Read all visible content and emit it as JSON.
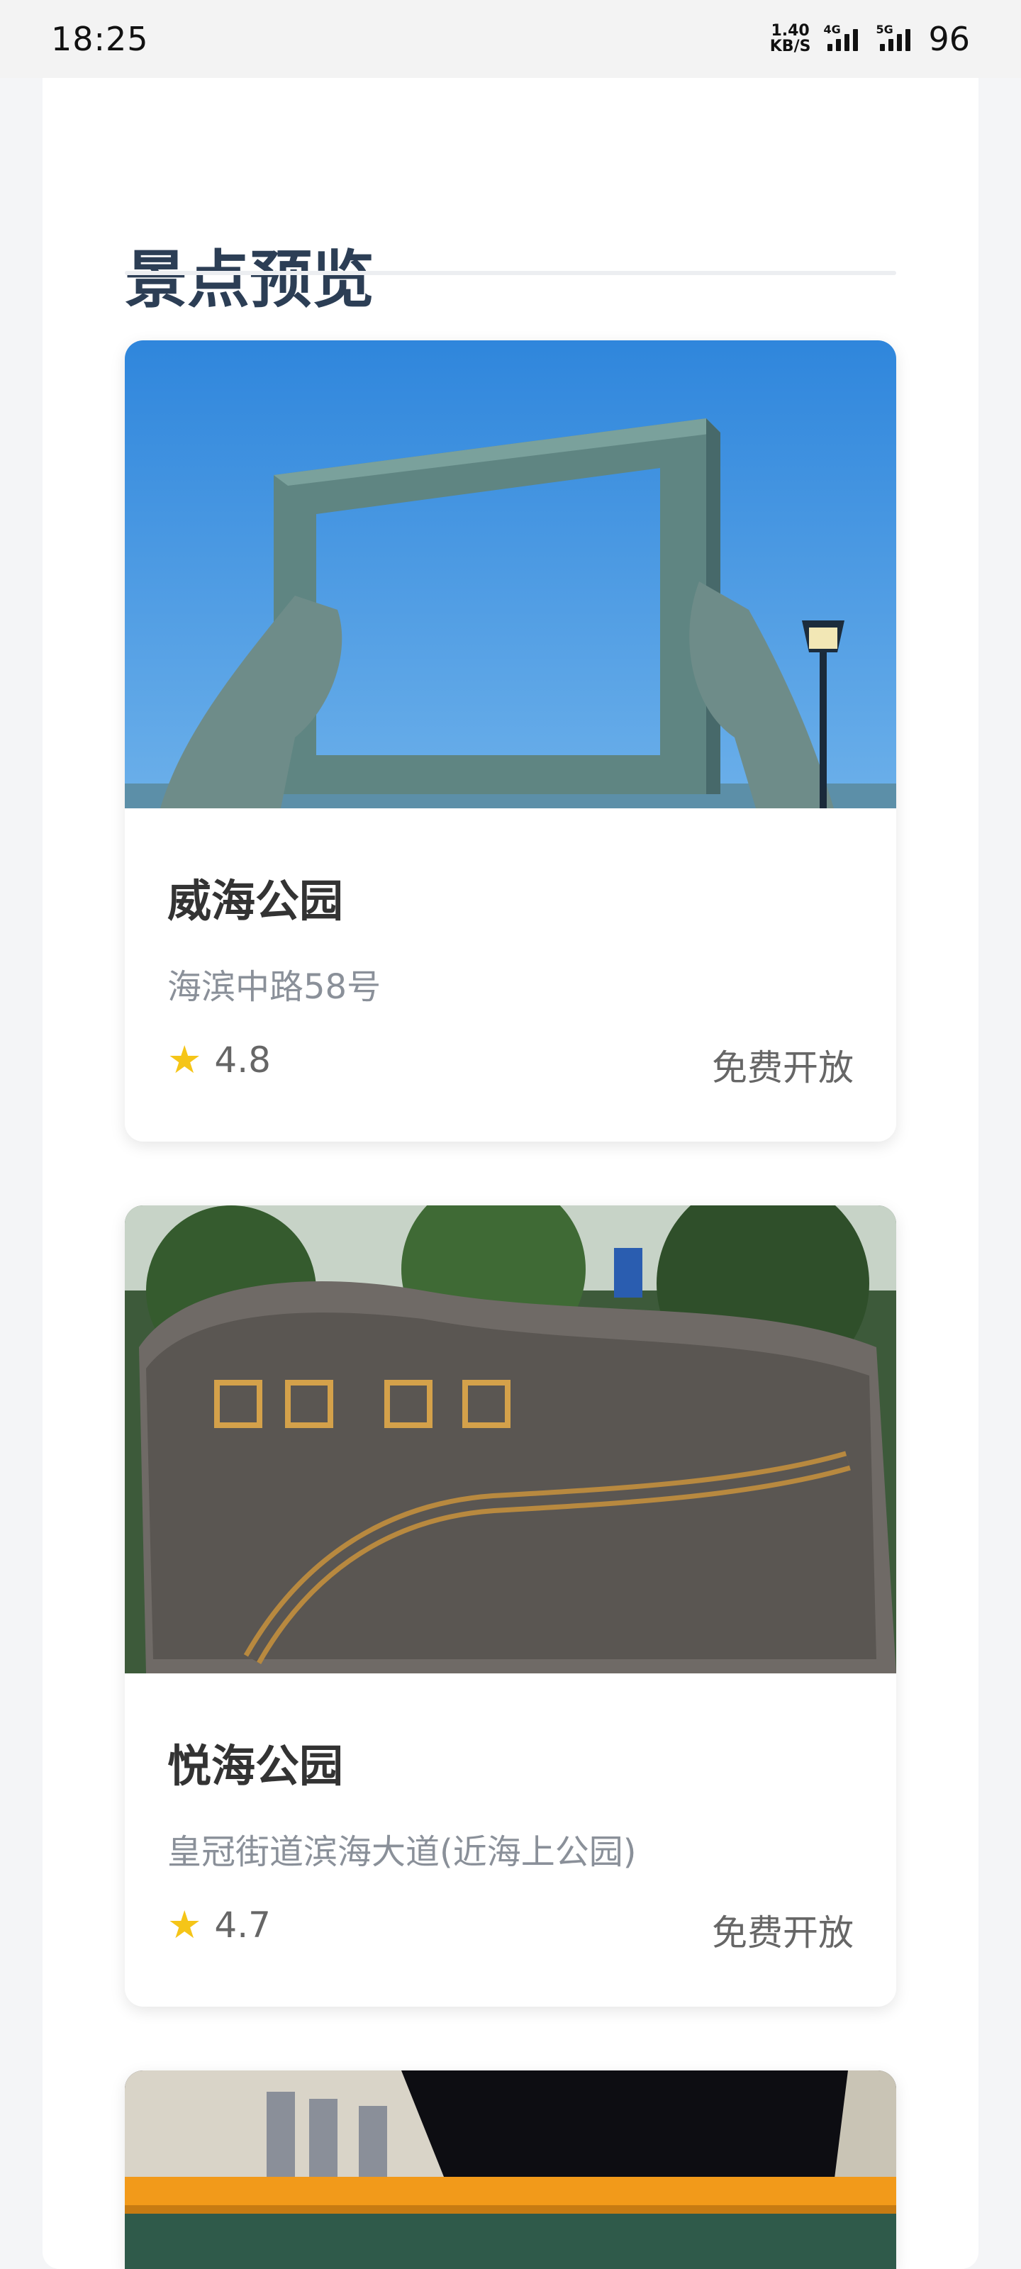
{
  "status_bar": {
    "time": "18:25",
    "net_speed_value": "1.40",
    "net_speed_unit": "KB/S",
    "signal1_tag": "4G",
    "signal2_tag": "5G",
    "battery": "96"
  },
  "page": {
    "title": "景点预览"
  },
  "spots": [
    {
      "name": "威海公园",
      "address": "海滨中路58号",
      "rating": "4.8",
      "price": "免费开放",
      "icon": "star-icon"
    },
    {
      "name": "悦海公园",
      "address": "皇冠街道滨海大道(近海上公园)",
      "rating": "4.7",
      "price": "免费开放",
      "icon": "star-icon"
    },
    {
      "name": "",
      "address": "",
      "rating": "",
      "price": ""
    }
  ],
  "colors": {
    "title": "#2c3e55",
    "star": "#f5c518",
    "address": "#8a9099"
  }
}
